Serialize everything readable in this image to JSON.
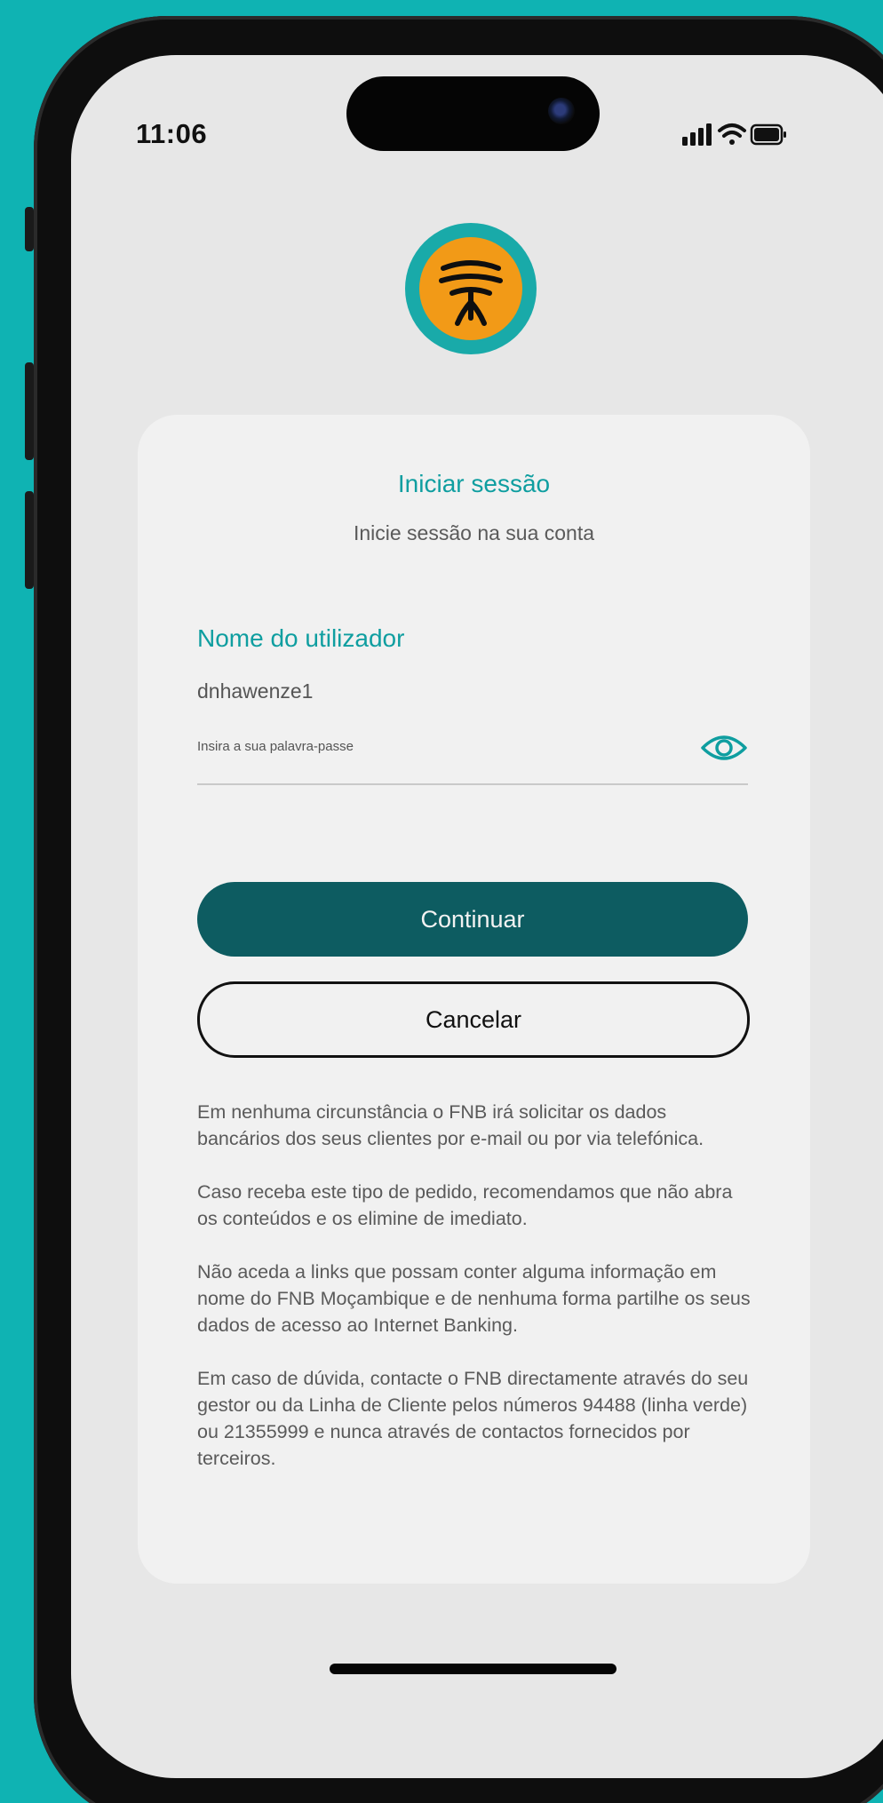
{
  "status_bar": {
    "time": "11:06",
    "icons": [
      "signal-icon",
      "wifi-icon",
      "battery-icon"
    ]
  },
  "brand": {
    "logo_icon": "fnb-tree-logo-icon",
    "accent_color": "#0f9ea0",
    "logo_ring_color": "#19aaa9",
    "logo_fill_color": "#f29a17",
    "primary_button_color": "#0d5c61"
  },
  "login": {
    "title": "Iniciar sessão",
    "subtitle": "Inicie sessão na sua conta",
    "username_label": "Nome do utilizador",
    "username_value": "dnhawenze1",
    "password_placeholder": "Insira a sua palavra-passe",
    "password_value": "",
    "continue_label": "Continuar",
    "cancel_label": "Cancelar"
  },
  "disclaimer": [
    "Em nenhuma circunstância o FNB irá solicitar os dados bancários dos seus clientes por e-mail ou por via telefónica.",
    "Caso receba este tipo de pedido, recomendamos que não abra os conteúdos e os elimine de imediato.",
    "Não aceda a links que possam conter alguma informação em nome do FNB Moçambique e de nenhuma forma partilhe os seus dados de acesso ao Internet Banking.",
    "Em caso de dúvida, contacte o FNB directamente através do seu gestor ou da Linha de Cliente pelos números 94488 (linha verde) ou 21355999 e nunca através de contactos fornecidos por terceiros."
  ]
}
